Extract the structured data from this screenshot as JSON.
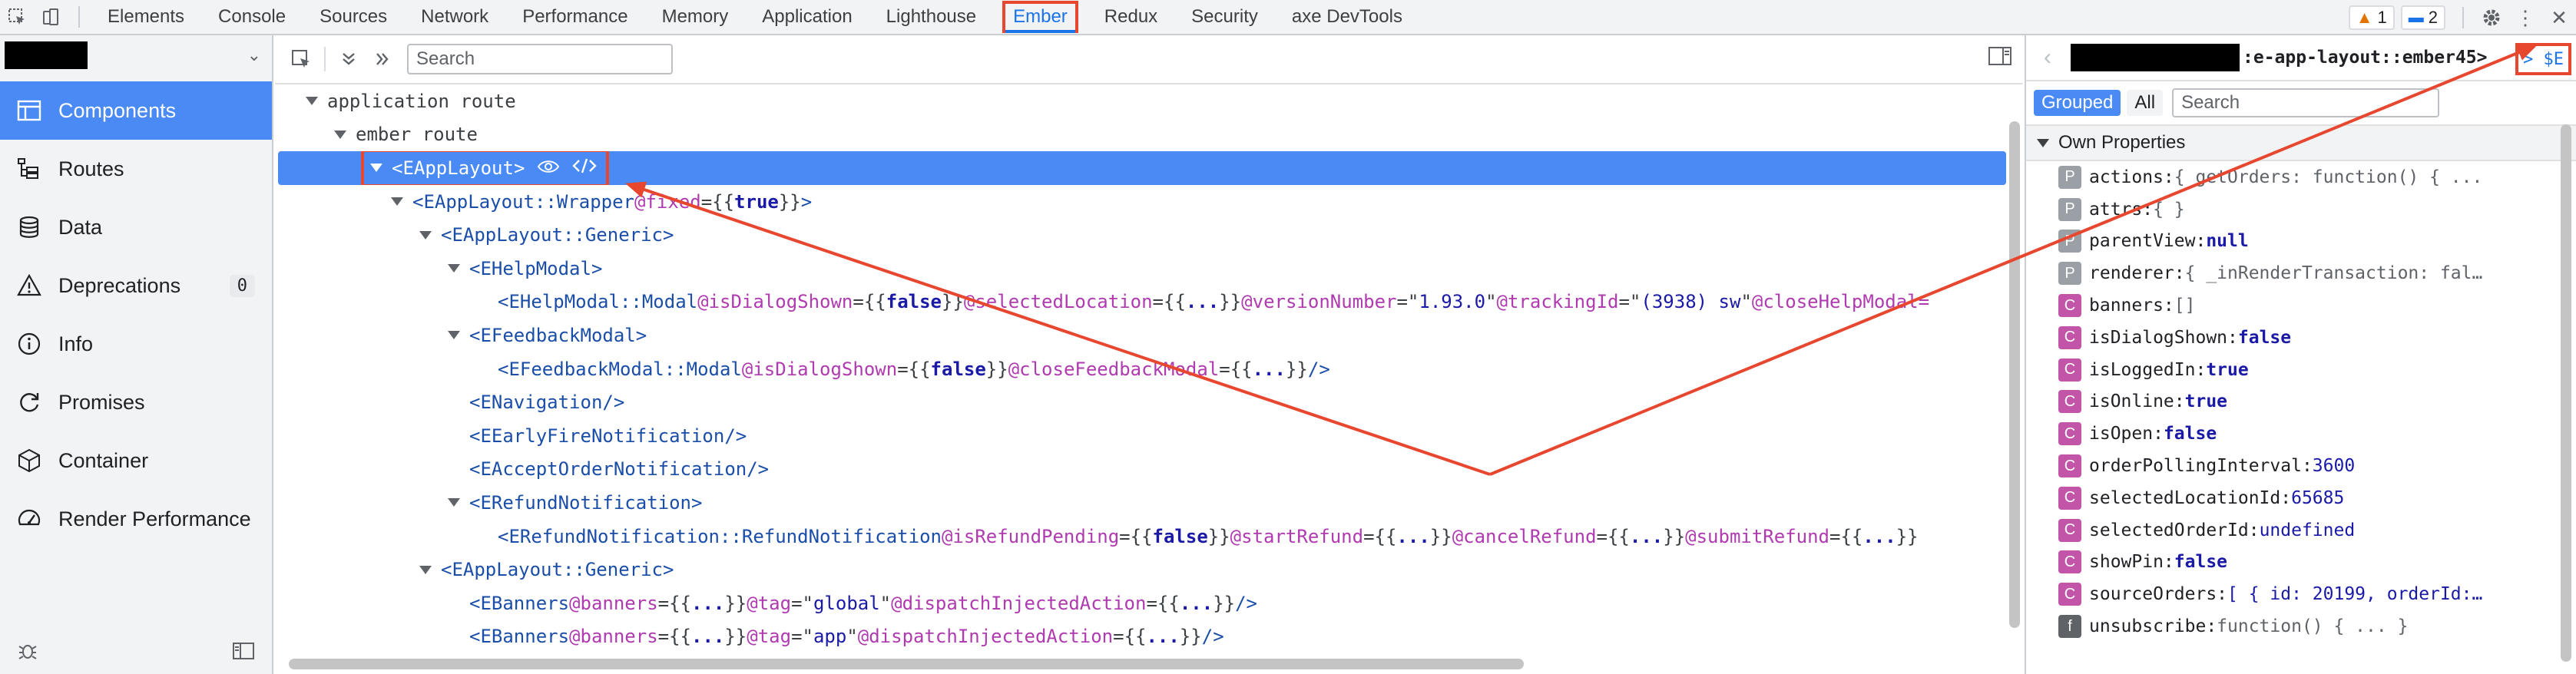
{
  "topbar": {
    "tabs": [
      "Elements",
      "Console",
      "Sources",
      "Network",
      "Performance",
      "Memory",
      "Application",
      "Lighthouse",
      "Ember",
      "Redux",
      "Security",
      "axe DevTools"
    ],
    "active_tab": "Ember",
    "warnings": "1",
    "messages": "2"
  },
  "sidebar": {
    "items": [
      {
        "label": "Components",
        "icon": "components-icon"
      },
      {
        "label": "Routes",
        "icon": "routes-icon"
      },
      {
        "label": "Data",
        "icon": "data-icon"
      },
      {
        "label": "Deprecations",
        "icon": "warning-icon",
        "count": "0"
      },
      {
        "label": "Info",
        "icon": "info-icon"
      },
      {
        "label": "Promises",
        "icon": "promises-icon"
      },
      {
        "label": "Container",
        "icon": "container-icon"
      },
      {
        "label": "Render Performance",
        "icon": "gauge-icon"
      }
    ]
  },
  "tree": {
    "search_placeholder": "Search",
    "rows": [
      {
        "indent": 0,
        "expand": true,
        "plain": "application route"
      },
      {
        "indent": 1,
        "expand": true,
        "plain": "ember route"
      },
      {
        "indent": 2,
        "expand": true,
        "selected": true,
        "tag": "<EAppLayout>"
      },
      {
        "indent": 3,
        "expand": true,
        "tag": "<EAppLayout::Wrapper",
        "parts": [
          [
            "attr",
            " @fixed"
          ],
          [
            "brace",
            "={{"
          ],
          [
            "kw",
            "true"
          ],
          [
            "brace",
            "}}"
          ],
          [
            "tag",
            ">"
          ]
        ]
      },
      {
        "indent": 4,
        "expand": true,
        "tag": "<EAppLayout::Generic>"
      },
      {
        "indent": 5,
        "expand": true,
        "tag": "<EHelpModal>"
      },
      {
        "indent": 6,
        "expand": false,
        "tag": "<EHelpModal::Modal",
        "parts": [
          [
            "attr",
            " @isDialogShown"
          ],
          [
            "brace",
            "={{"
          ],
          [
            "kw",
            "false"
          ],
          [
            "brace",
            "}}"
          ],
          [
            "attr",
            " @selectedLocation"
          ],
          [
            "brace",
            "={{"
          ],
          [
            "kw",
            "..."
          ],
          [
            "brace",
            "}}"
          ],
          [
            "attr",
            " @versionNumber"
          ],
          [
            "brace",
            "=\""
          ],
          [
            "str",
            "1.93.0"
          ],
          [
            "brace",
            "\""
          ],
          [
            "attr",
            " @trackingId"
          ],
          [
            "brace",
            "=\""
          ],
          [
            "str",
            "(3938) sw"
          ],
          [
            "brace",
            "\""
          ],
          [
            "attr",
            " @closeHelpModal="
          ]
        ]
      },
      {
        "indent": 5,
        "expand": true,
        "tag": "<EFeedbackModal>"
      },
      {
        "indent": 6,
        "expand": false,
        "tag": "<EFeedbackModal::Modal",
        "parts": [
          [
            "attr",
            " @isDialogShown"
          ],
          [
            "brace",
            "={{"
          ],
          [
            "kw",
            "false"
          ],
          [
            "brace",
            "}}"
          ],
          [
            "attr",
            " @closeFeedbackModal"
          ],
          [
            "brace",
            "={{"
          ],
          [
            "kw",
            "..."
          ],
          [
            "brace",
            "}}"
          ],
          [
            "tag",
            "/>"
          ]
        ]
      },
      {
        "indent": 5,
        "expand": false,
        "tag": "<ENavigation/>"
      },
      {
        "indent": 5,
        "expand": false,
        "tag": "<EEarlyFireNotification/>"
      },
      {
        "indent": 5,
        "expand": false,
        "tag": "<EAcceptOrderNotification/>"
      },
      {
        "indent": 5,
        "expand": true,
        "tag": "<ERefundNotification>"
      },
      {
        "indent": 6,
        "expand": false,
        "tag": "<ERefundNotification::RefundNotification",
        "parts": [
          [
            "attr",
            " @isRefundPending"
          ],
          [
            "brace",
            "={{"
          ],
          [
            "kw",
            "false"
          ],
          [
            "brace",
            "}}"
          ],
          [
            "attr",
            " @startRefund"
          ],
          [
            "brace",
            "={{"
          ],
          [
            "kw",
            "..."
          ],
          [
            "brace",
            "}}"
          ],
          [
            "attr",
            " @cancelRefund"
          ],
          [
            "brace",
            "={{"
          ],
          [
            "kw",
            "..."
          ],
          [
            "brace",
            "}}"
          ],
          [
            "attr",
            " @submitRefund"
          ],
          [
            "brace",
            "={{"
          ],
          [
            "kw",
            "..."
          ],
          [
            "brace",
            "}}"
          ]
        ]
      },
      {
        "indent": 4,
        "expand": true,
        "tag": "<EAppLayout::Generic>"
      },
      {
        "indent": 5,
        "expand": false,
        "tag": "<EBanners",
        "parts": [
          [
            "attr",
            " @banners"
          ],
          [
            "brace",
            "={{"
          ],
          [
            "kw",
            "..."
          ],
          [
            "brace",
            "}}"
          ],
          [
            "attr",
            " @tag"
          ],
          [
            "brace",
            "=\""
          ],
          [
            "str",
            "global"
          ],
          [
            "brace",
            "\""
          ],
          [
            "attr",
            " @dispatchInjectedAction"
          ],
          [
            "brace",
            "={{"
          ],
          [
            "kw",
            "..."
          ],
          [
            "brace",
            "}}"
          ],
          [
            "tag",
            "/>"
          ]
        ]
      },
      {
        "indent": 5,
        "expand": false,
        "tag": "<EBanners",
        "parts": [
          [
            "attr",
            " @banners"
          ],
          [
            "brace",
            "={{"
          ],
          [
            "kw",
            "..."
          ],
          [
            "brace",
            "}}"
          ],
          [
            "attr",
            " @tag"
          ],
          [
            "brace",
            "=\""
          ],
          [
            "str",
            "app"
          ],
          [
            "brace",
            "\""
          ],
          [
            "attr",
            " @dispatchInjectedAction"
          ],
          [
            "brace",
            "={{"
          ],
          [
            "kw",
            "..."
          ],
          [
            "brace",
            "}}"
          ],
          [
            "tag",
            "/>"
          ]
        ]
      }
    ]
  },
  "props": {
    "object_name": ":e-app-layout::ember45>",
    "dollar_label": "> $E",
    "tab_grouped": "Grouped",
    "tab_all": "All",
    "search_placeholder": "Search",
    "section": "Own Properties",
    "rows": [
      {
        "type": "P",
        "key": "actions:",
        "value": " { getOrders: function() { ...",
        "style": "gray"
      },
      {
        "type": "P",
        "key": "attrs:",
        "value": " { }",
        "style": "gray"
      },
      {
        "type": "P",
        "key": "parentView:",
        "value": " null",
        "style": "bold"
      },
      {
        "type": "P",
        "key": "renderer:",
        "value": " { _inRenderTransaction: fal…",
        "style": "gray"
      },
      {
        "type": "C",
        "key": "banners:",
        "value": " []",
        "style": "gray"
      },
      {
        "type": "C",
        "key": "isDialogShown:",
        "value": " false",
        "style": "bold"
      },
      {
        "type": "C",
        "key": "isLoggedIn:",
        "value": " true",
        "style": "bold"
      },
      {
        "type": "C",
        "key": "isOnline:",
        "value": " true",
        "style": "bold"
      },
      {
        "type": "C",
        "key": "isOpen:",
        "value": " false",
        "style": "bold"
      },
      {
        "type": "C",
        "key": "orderPollingInterval:",
        "value": " 3600",
        "style": "plain"
      },
      {
        "type": "C",
        "key": "selectedLocationId:",
        "value": " 65685",
        "style": "plain"
      },
      {
        "type": "C",
        "key": "selectedOrderId:",
        "value": " undefined",
        "style": "plain"
      },
      {
        "type": "C",
        "key": "showPin:",
        "value": " false",
        "style": "bold"
      },
      {
        "type": "C",
        "key": "sourceOrders:",
        "value": " [ { id: 20199, orderId:…",
        "style": "plain"
      },
      {
        "type": "f",
        "key": "unsubscribe:",
        "value": " function() { ... }",
        "style": "gray"
      }
    ]
  },
  "colors": {
    "accent": "#4a8af4",
    "annotation": "#e8472f"
  }
}
